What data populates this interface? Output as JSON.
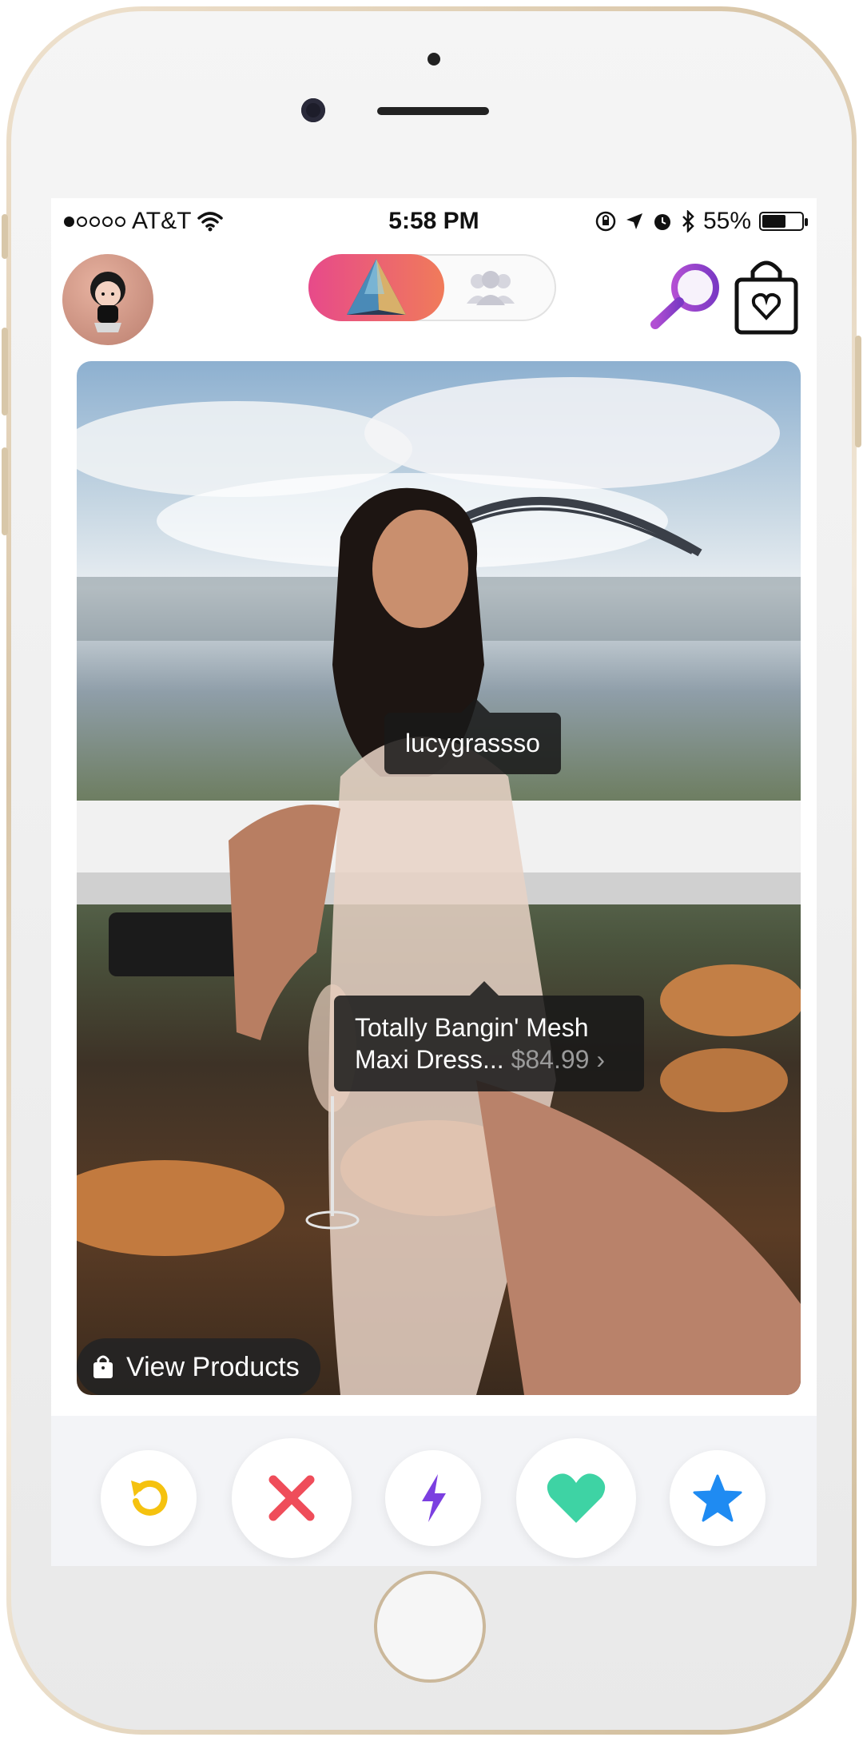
{
  "status_bar": {
    "carrier": "AT&T",
    "time": "5:58 PM",
    "battery": "55%",
    "signal_bars_filled": 1,
    "signal_bars_total": 5
  },
  "header": {
    "mode_toggle_selected": "pyramid-icon",
    "mode_toggle_other": "group-icon",
    "search_icon": "search-icon",
    "bag_icon": "shopping-bag-heart-icon"
  },
  "feed": {
    "username_tag": "lucygrassso",
    "product_tag_title": "Totally Bangin' Mesh Maxi Dress...",
    "product_tag_price": "$84.99",
    "view_products_label": "View Products"
  },
  "actions": [
    {
      "name": "rewind-icon",
      "color": "#f5c20f"
    },
    {
      "name": "close-icon",
      "color": "#ef4d5a"
    },
    {
      "name": "bolt-icon",
      "color": "#7b3fe0"
    },
    {
      "name": "heart-icon",
      "color": "#3ed3a4"
    },
    {
      "name": "star-icon",
      "color": "#1f8bf2"
    }
  ],
  "colors": {
    "toggle_gradient_start": "#e74a8a",
    "toggle_gradient_end": "#f07b5a",
    "search_purple": "#8b3fc9"
  }
}
